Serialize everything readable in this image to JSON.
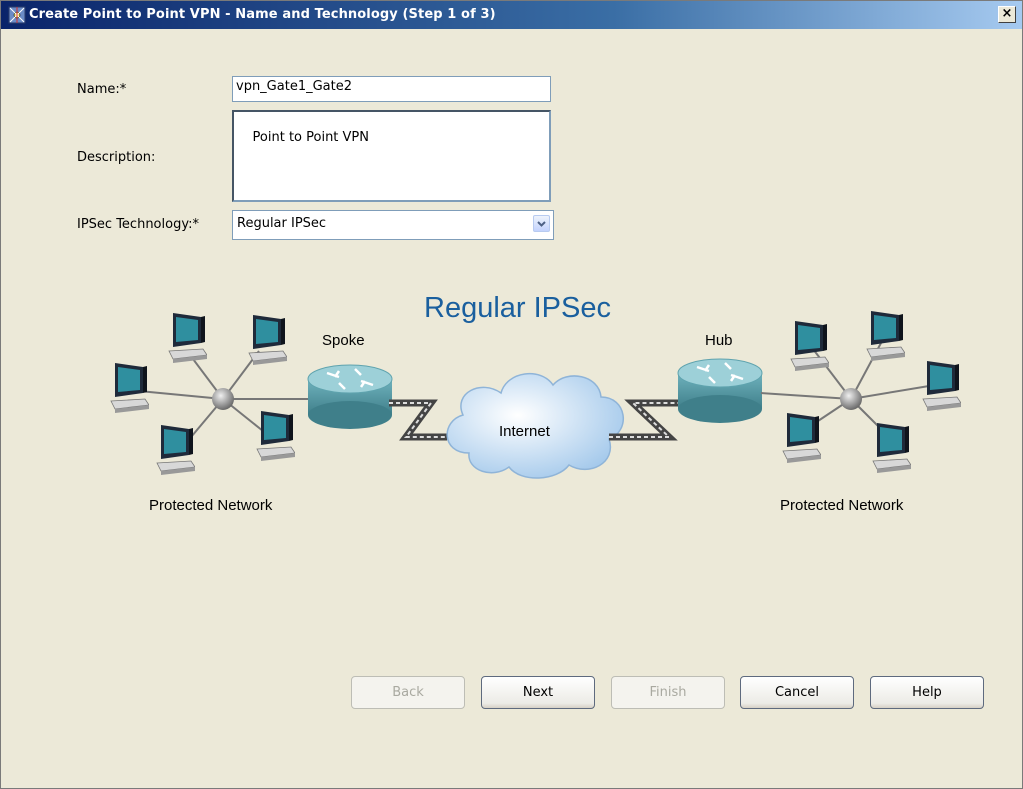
{
  "window": {
    "title": "Create Point to Point VPN - Name and Technology (Step 1 of 3)",
    "close_label": "×"
  },
  "form": {
    "name_label": "Name:*",
    "name_value": "vpn_Gate1_Gate2",
    "description_label": "Description:",
    "description_value": "Point to Point VPN",
    "technology_label": "IPSec Technology:*",
    "technology_value": "Regular IPSec"
  },
  "diagram": {
    "title": "Regular IPSec",
    "spoke_label": "Spoke",
    "hub_label": "Hub",
    "internet_label": "Internet",
    "left_network_label": "Protected Network",
    "right_network_label": "Protected Network",
    "title_color": "#1a5f9e",
    "router_color": "#5fa3ae"
  },
  "buttons": {
    "back": "Back",
    "next": "Next",
    "finish": "Finish",
    "cancel": "Cancel",
    "help": "Help"
  }
}
